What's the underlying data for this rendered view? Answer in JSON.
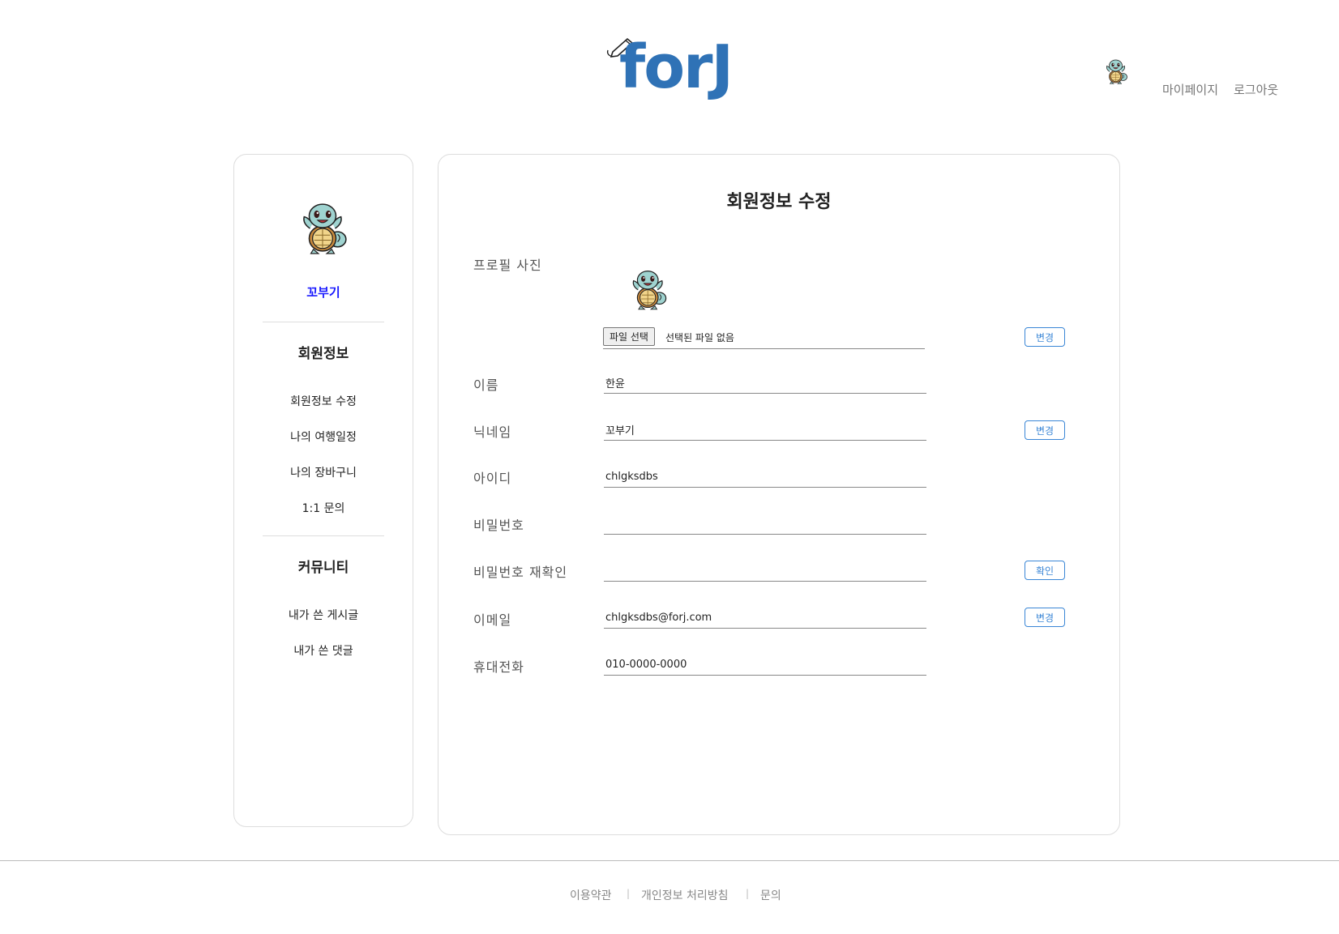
{
  "header": {
    "logo_text": "forJ",
    "nav": {
      "mypage": "마이페이지",
      "logout": "로그아웃"
    }
  },
  "sidebar": {
    "nickname": "꼬부기",
    "section_member": "회원정보",
    "member_items": [
      "회원정보 수정",
      "나의 여행일정",
      "나의 장바구니",
      "1:1 문의"
    ],
    "section_community": "커뮤니티",
    "community_items": [
      "내가 쓴 게시글",
      "내가 쓴 댓글"
    ]
  },
  "main": {
    "title": "회원정보 수정",
    "labels": {
      "photo": "프로필 사진",
      "name": "이름",
      "nickname": "닉네임",
      "userid": "아이디",
      "password": "비밀번호",
      "password_confirm": "비밀번호 재확인",
      "email": "이메일",
      "phone": "휴대전화"
    },
    "file": {
      "button": "파일 선택",
      "status": "선택된 파일 없음"
    },
    "values": {
      "name": "한윤",
      "nickname": "꼬부기",
      "userid": "chlgksdbs",
      "password": "",
      "password_confirm": "",
      "email": "chlgksdbs@forj.com",
      "phone": "010-0000-0000"
    },
    "buttons": {
      "photo_change": "변경",
      "nickname_change": "변경",
      "password_check": "확인",
      "email_change": "변경"
    }
  },
  "footer": {
    "terms": "이용약관",
    "privacy": "개인정보 처리방침",
    "inquiry": "문의",
    "separator": "|"
  },
  "colors": {
    "brand": "#2f72b6",
    "accent_button": "#3a86d6",
    "nickname": "#1a1aff"
  },
  "icons": {
    "avatar": "turtle-avatar-icon",
    "logo_mark": "pencil-icon"
  }
}
